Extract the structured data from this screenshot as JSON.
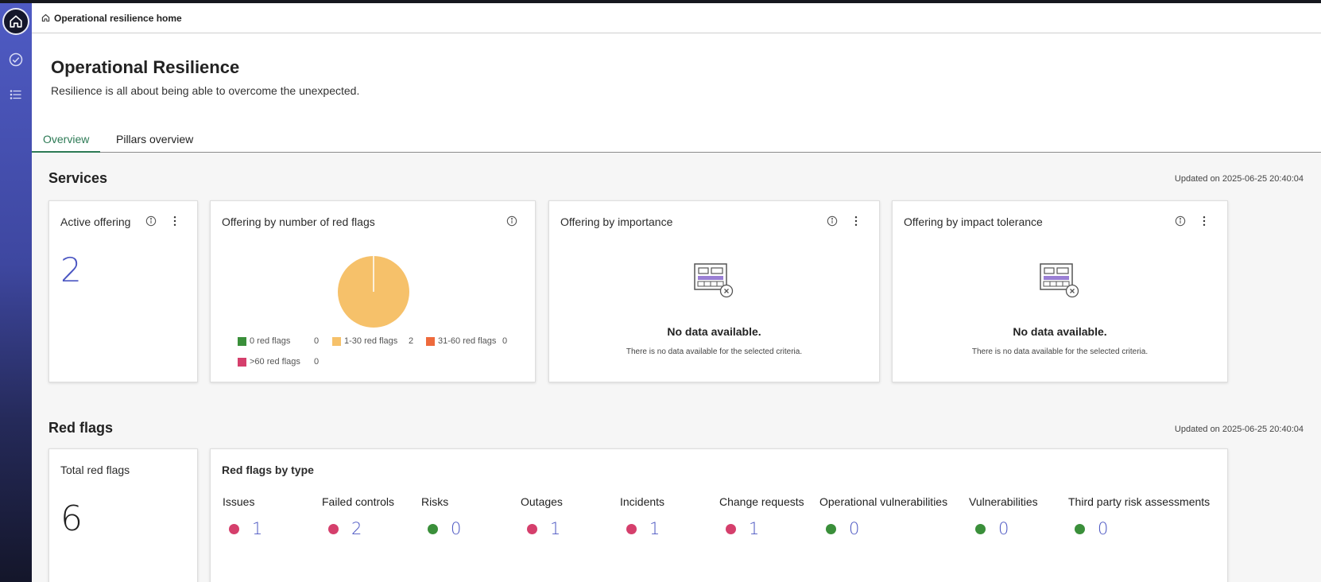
{
  "breadcrumb": {
    "label": "Operational resilience home"
  },
  "header": {
    "title": "Operational Resilience",
    "subtitle": "Resilience is all about being able to overcome the unexpected."
  },
  "tabs": [
    {
      "label": "Overview",
      "active": true
    },
    {
      "label": "Pillars overview",
      "active": false
    }
  ],
  "services": {
    "title": "Services",
    "updated": "Updated on 2025-06-25 20:40:04",
    "active_offering": {
      "title": "Active offering",
      "value": "2"
    },
    "red_flag_offering": {
      "title": "Offering by number of red flags",
      "legend": [
        {
          "label": "0 red flags",
          "count": "0",
          "color": "#3a8f3a"
        },
        {
          "label": "1-30 red flags",
          "count": "2",
          "color": "#f6c16a"
        },
        {
          "label": "31-60 red flags",
          "count": "0",
          "color": "#ee6a3c"
        },
        {
          "label": ">60 red flags",
          "count": "0",
          "color": "#d53f6c"
        }
      ]
    },
    "importance": {
      "title": "Offering by importance",
      "nodata_title": "No data available.",
      "nodata_desc": "There is no data available for the selected criteria."
    },
    "impact_tolerance": {
      "title": "Offering by impact tolerance",
      "nodata_title": "No data available.",
      "nodata_desc": "There is no data available for the selected criteria."
    }
  },
  "red_flags": {
    "title": "Red flags",
    "updated": "Updated on 2025-06-25 20:40:04",
    "total": {
      "title": "Total red flags",
      "value": "6"
    },
    "by_type": {
      "title": "Red flags by type",
      "items": [
        {
          "label": "Issues",
          "value": "1",
          "status": "red"
        },
        {
          "label": "Failed controls",
          "value": "2",
          "status": "red"
        },
        {
          "label": "Risks",
          "value": "0",
          "status": "green"
        },
        {
          "label": "Outages",
          "value": "1",
          "status": "red"
        },
        {
          "label": "Incidents",
          "value": "1",
          "status": "red"
        },
        {
          "label": "Change requests",
          "value": "1",
          "status": "red"
        },
        {
          "label": "Operational vulnerabilities",
          "value": "0",
          "status": "green"
        },
        {
          "label": "Vulnerabilities",
          "value": "0",
          "status": "green"
        },
        {
          "label": "Third party risk assessments",
          "value": "0",
          "status": "green"
        }
      ]
    }
  },
  "colors": {
    "accent_blue": "#4a55c2",
    "tab_active": "#2d7a55",
    "status_red": "#d53f6c",
    "status_green": "#3a8f3a",
    "pie_fill": "#f6c16a"
  },
  "icons": {
    "sidebar": [
      "home-icon",
      "check-circle-icon",
      "list-icon"
    ],
    "card": [
      "info-icon",
      "more-vertical-icon"
    ],
    "empty_state": "no-data-icon"
  }
}
